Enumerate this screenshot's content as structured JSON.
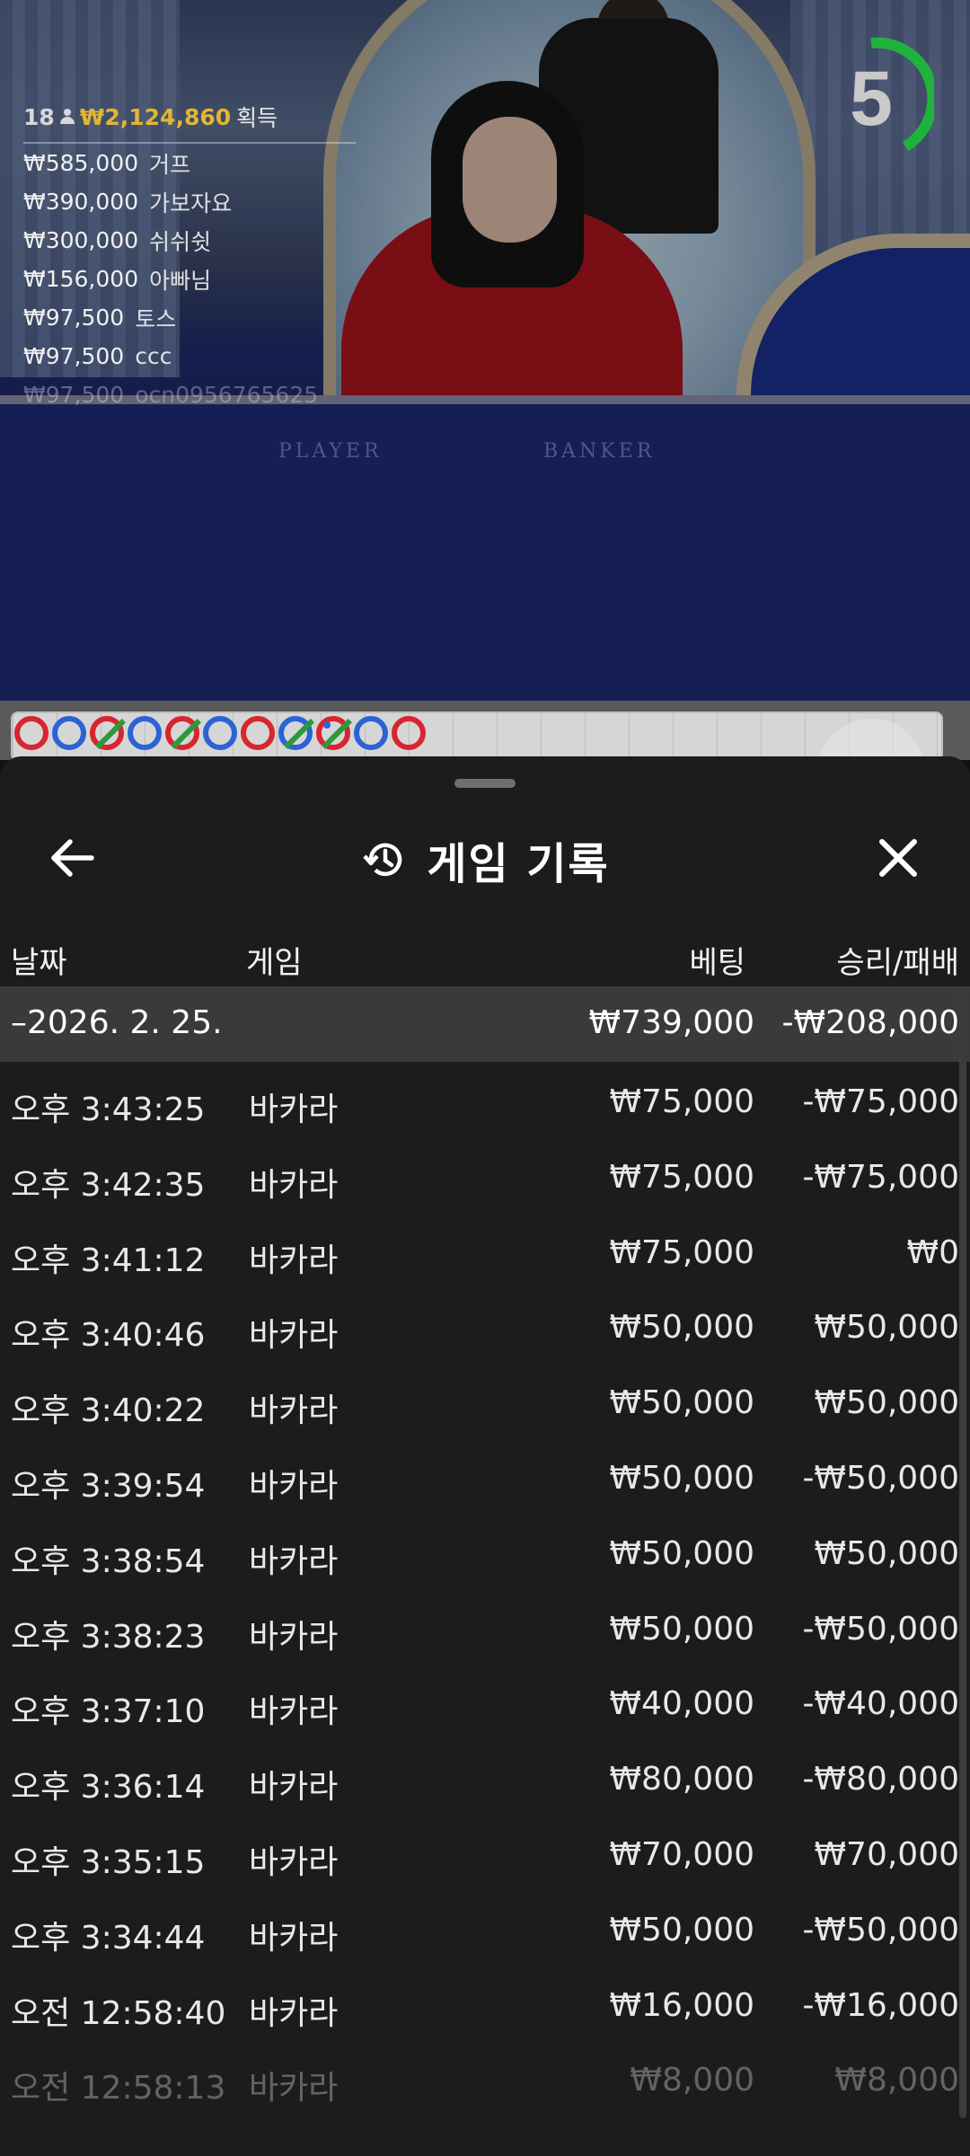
{
  "leaderboard": {
    "player_count": "18",
    "total_win": "₩2,124,860",
    "total_label": "획득",
    "entries": [
      {
        "amount": "₩585,000",
        "name": "거프"
      },
      {
        "amount": "₩390,000",
        "name": "가보자요"
      },
      {
        "amount": "₩300,000",
        "name": "쉬쉬쉿"
      },
      {
        "amount": "₩156,000",
        "name": "아빠님"
      },
      {
        "amount": "₩97,500",
        "name": "토스"
      },
      {
        "amount": "₩97,500",
        "name": "ccc"
      },
      {
        "amount": "₩97,500",
        "name": "ocn0956765625"
      }
    ]
  },
  "table_felt": {
    "player_label": "PLAYER",
    "banker_label": "BANKER"
  },
  "countdown": {
    "seconds": "5",
    "color": "#1fb33b"
  },
  "road": [
    {
      "side": "red"
    },
    {
      "side": "blue"
    },
    {
      "side": "red",
      "tie": true
    },
    {
      "side": "blue"
    },
    {
      "side": "red",
      "tie": true
    },
    {
      "side": "blue"
    },
    {
      "side": "red"
    },
    {
      "side": "blue",
      "tie": true
    },
    {
      "side": "red",
      "tie": true,
      "pair": true
    },
    {
      "side": "blue"
    },
    {
      "side": "red"
    }
  ],
  "sheet": {
    "title": "게임 기록",
    "icons": {
      "back": "arrow-left-icon",
      "history": "history-clock-icon",
      "close": "close-x-icon"
    },
    "columns": {
      "date": "날짜",
      "game": "게임",
      "bet": "베팅",
      "result": "승리/패배"
    },
    "date_group": {
      "date": "–2026. 2. 25.",
      "bet_total": "₩739,000",
      "result_total": "-₩208,000"
    },
    "records": [
      {
        "time": "오후 3:43:25",
        "game": "바카라",
        "bet": "₩75,000",
        "result": "-₩75,000"
      },
      {
        "time": "오후 3:42:35",
        "game": "바카라",
        "bet": "₩75,000",
        "result": "-₩75,000"
      },
      {
        "time": "오후 3:41:12",
        "game": "바카라",
        "bet": "₩75,000",
        "result": "₩0"
      },
      {
        "time": "오후 3:40:46",
        "game": "바카라",
        "bet": "₩50,000",
        "result": "₩50,000"
      },
      {
        "time": "오후 3:40:22",
        "game": "바카라",
        "bet": "₩50,000",
        "result": "₩50,000"
      },
      {
        "time": "오후 3:39:54",
        "game": "바카라",
        "bet": "₩50,000",
        "result": "-₩50,000"
      },
      {
        "time": "오후 3:38:54",
        "game": "바카라",
        "bet": "₩50,000",
        "result": "₩50,000"
      },
      {
        "time": "오후 3:38:23",
        "game": "바카라",
        "bet": "₩50,000",
        "result": "-₩50,000"
      },
      {
        "time": "오후 3:37:10",
        "game": "바카라",
        "bet": "₩40,000",
        "result": "-₩40,000"
      },
      {
        "time": "오후 3:36:14",
        "game": "바카라",
        "bet": "₩80,000",
        "result": "-₩80,000"
      },
      {
        "time": "오후 3:35:15",
        "game": "바카라",
        "bet": "₩70,000",
        "result": "₩70,000"
      },
      {
        "time": "오후 3:34:44",
        "game": "바카라",
        "bet": "₩50,000",
        "result": "-₩50,000"
      },
      {
        "time": "오전 12:58:40",
        "game": "바카라",
        "bet": "₩16,000",
        "result": "-₩16,000"
      },
      {
        "time": "오전 12:58:13",
        "game": "바카라",
        "bet": "₩8,000",
        "result": "₩8,000"
      }
    ]
  }
}
